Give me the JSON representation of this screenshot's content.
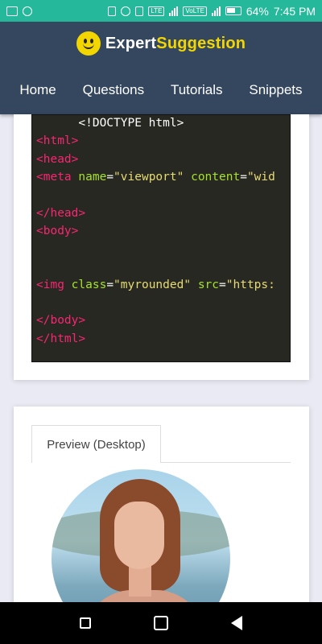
{
  "status_bar": {
    "battery": "64%",
    "time": "7:45 PM",
    "tags": [
      "LTE",
      "VoLTE",
      "VoLTE"
    ]
  },
  "header": {
    "brand_part1": "Expert",
    "brand_part2": "Suggestion",
    "nav": [
      "Home",
      "Questions",
      "Tutorials",
      "Snippets"
    ]
  },
  "code": {
    "lines": [
      {
        "parts": [
          {
            "t": "      <!DOCTYPE html>",
            "c": "doctype"
          }
        ]
      },
      {
        "parts": [
          {
            "t": "<html>",
            "c": "tag"
          }
        ]
      },
      {
        "parts": [
          {
            "t": "<head>",
            "c": "tag"
          }
        ]
      },
      {
        "parts": [
          {
            "t": "<meta ",
            "c": "tag"
          },
          {
            "t": "name",
            "c": "attr"
          },
          {
            "t": "=",
            "c": "plain"
          },
          {
            "t": "\"viewport\"",
            "c": "str"
          },
          {
            "t": " ",
            "c": "plain"
          },
          {
            "t": "content",
            "c": "attr"
          },
          {
            "t": "=",
            "c": "plain"
          },
          {
            "t": "\"wid",
            "c": "str"
          }
        ]
      },
      {
        "parts": [
          {
            "t": "",
            "c": "plain"
          }
        ]
      },
      {
        "parts": [
          {
            "t": "</head>",
            "c": "tag"
          }
        ]
      },
      {
        "parts": [
          {
            "t": "<body>",
            "c": "tag"
          }
        ]
      },
      {
        "parts": [
          {
            "t": "",
            "c": "plain"
          }
        ]
      },
      {
        "parts": [
          {
            "t": "",
            "c": "plain"
          }
        ]
      },
      {
        "parts": [
          {
            "t": "<img ",
            "c": "tag"
          },
          {
            "t": "class",
            "c": "attr"
          },
          {
            "t": "=",
            "c": "plain"
          },
          {
            "t": "\"myrounded\"",
            "c": "str"
          },
          {
            "t": " ",
            "c": "plain"
          },
          {
            "t": "src",
            "c": "attr"
          },
          {
            "t": "=",
            "c": "plain"
          },
          {
            "t": "\"https:",
            "c": "str"
          }
        ]
      },
      {
        "parts": [
          {
            "t": "",
            "c": "plain"
          }
        ]
      },
      {
        "parts": [
          {
            "t": "</body>",
            "c": "tag"
          }
        ]
      },
      {
        "parts": [
          {
            "t": "</html>",
            "c": "tag"
          }
        ]
      }
    ]
  },
  "preview": {
    "tab_label": "Preview (Desktop)"
  },
  "colors": {
    "status_bar": "#26b89a",
    "header": "#34475f",
    "brand_accent": "#f3d600",
    "code_bg": "#272822",
    "code_tag": "#f92672",
    "code_attr": "#a6e22e",
    "code_string": "#e6db74"
  }
}
